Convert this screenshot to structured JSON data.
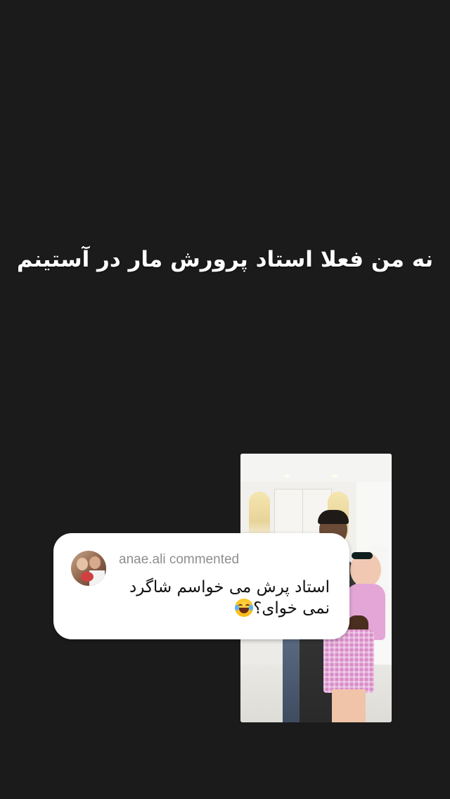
{
  "story": {
    "caption": "نه من فعلا استاد پرورش مار در آستینم"
  },
  "video": {
    "meta_left": "",
    "meta_right": ""
  },
  "comment": {
    "header": "anae.ali commented",
    "line1": "استاد پرش می خواسم شاگرد",
    "line2": "نمی خوای؟",
    "emoji": "face-with-tears-of-joy-icon"
  },
  "colors": {
    "background": "#1b1b1b",
    "caption_text": "#ffffff",
    "card_background": "#ffffff",
    "username_text": "#8e8e8e",
    "comment_text": "#111111"
  }
}
